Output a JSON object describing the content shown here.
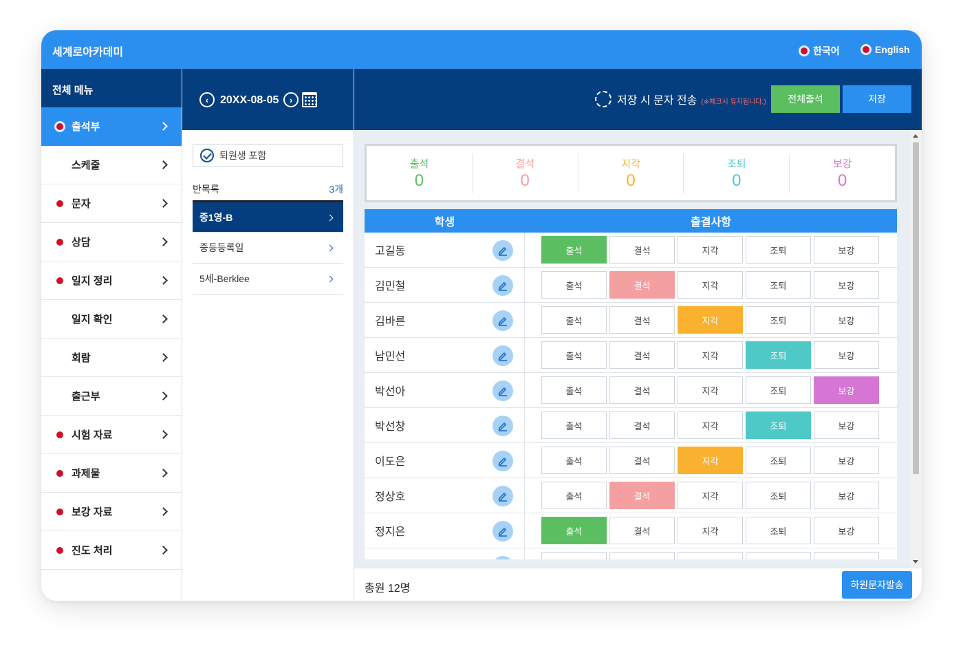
{
  "app": {
    "title": "세계로아카데미",
    "languages": [
      {
        "label": "한국어"
      },
      {
        "label": "English"
      }
    ],
    "colors": {
      "primary": "#2b8ff0",
      "navy": "#053e7f",
      "present": "#5bbf62",
      "absent": "#f4a0a1",
      "late": "#fbb130",
      "early": "#4ec9c8",
      "makeup": "#d676d4",
      "indicator": "#d01028"
    }
  },
  "sidebar": {
    "header": "전체 메뉴",
    "items": [
      {
        "label": "출석부",
        "dot": true,
        "active": true
      },
      {
        "label": "스케줄",
        "dot": false,
        "active": false
      },
      {
        "label": "문자",
        "dot": true,
        "active": false
      },
      {
        "label": "상담",
        "dot": true,
        "active": false
      },
      {
        "label": "일지 정리",
        "dot": true,
        "active": false
      },
      {
        "label": "일지 확인",
        "dot": false,
        "active": false
      },
      {
        "label": "회람",
        "dot": false,
        "active": false
      },
      {
        "label": "출근부",
        "dot": false,
        "active": false
      },
      {
        "label": "시험 자료",
        "dot": true,
        "active": false
      },
      {
        "label": "과제물",
        "dot": true,
        "active": false
      },
      {
        "label": "보강 자료",
        "dot": true,
        "active": false
      },
      {
        "label": "진도 처리",
        "dot": true,
        "active": false
      }
    ]
  },
  "classpanel": {
    "date": "20XX-08-05",
    "include_withdrawn": "퇴원생 포함",
    "list_title": "반목록",
    "list_count": "3개",
    "classes": [
      {
        "label": "중1영-B",
        "active": true
      },
      {
        "label": "중등등록일",
        "active": false
      },
      {
        "label": "5세-Berklee",
        "active": false
      }
    ]
  },
  "actions": {
    "sms_on_save": "저장 시 문자 전송",
    "sms_note": "(※체크시 유지됩니다.)",
    "all_present": "전체출석",
    "save": "저장"
  },
  "summary": [
    {
      "label": "출석",
      "value": "0",
      "color": "#5bbf62"
    },
    {
      "label": "결석",
      "value": "0",
      "color": "#f4a0a1"
    },
    {
      "label": "지각",
      "value": "0",
      "color": "#fbb130"
    },
    {
      "label": "조퇴",
      "value": "0",
      "color": "#4ec9c8"
    },
    {
      "label": "보강",
      "value": "0",
      "color": "#d676d4"
    }
  ],
  "table": {
    "headers": {
      "student": "학생",
      "attendance": "출결사항"
    },
    "options": [
      "출석",
      "결석",
      "지각",
      "조퇴",
      "보강"
    ],
    "students": [
      {
        "name": "고길동",
        "status": "출석"
      },
      {
        "name": "김민철",
        "status": "결석"
      },
      {
        "name": "김바른",
        "status": "지각"
      },
      {
        "name": "남민선",
        "status": "조퇴"
      },
      {
        "name": "박선아",
        "status": "보강"
      },
      {
        "name": "박선창",
        "status": "조퇴"
      },
      {
        "name": "이도은",
        "status": "지각"
      },
      {
        "name": "정상호",
        "status": "결석"
      },
      {
        "name": "정지은",
        "status": "출석"
      },
      {
        "name": "",
        "status": ""
      }
    ]
  },
  "footer": {
    "total": "총원 12명",
    "send_sms": "하원문자발송"
  }
}
